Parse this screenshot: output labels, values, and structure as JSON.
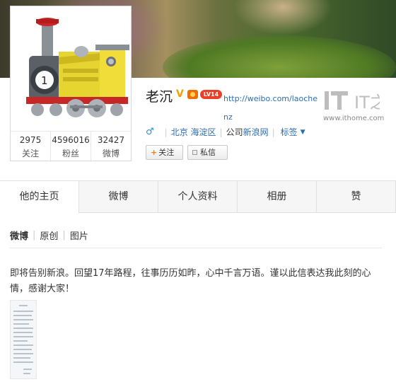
{
  "profile": {
    "name": "老沉",
    "verified_mark": "V",
    "level": "LV14",
    "url": "http://weibo.com/laochenz",
    "gender_icon": "male-icon",
    "location": "北京 海淀区",
    "company_label": "公司",
    "company": "新浪网",
    "tag_label": "标签"
  },
  "stats": [
    {
      "value": "2975",
      "label": "关注"
    },
    {
      "value": "4596016",
      "label": "粉丝"
    },
    {
      "value": "32427",
      "label": "微博"
    }
  ],
  "actions": {
    "follow": "关注",
    "message": "私信"
  },
  "watermark": {
    "logo": "IT之家",
    "url": "www.ithome.com"
  },
  "tabs": [
    "他的主页",
    "微博",
    "个人资料",
    "相册",
    "赞"
  ],
  "subtabs": [
    "微博",
    "原创",
    "图片"
  ],
  "post": {
    "text": "即将告别新浪。回望17年路程，往事历历如昨，心中千言万语。谨以此信表达我此刻的心情，感谢大家！"
  },
  "colors": {
    "link": "#2c6db0",
    "accent": "#ff7a00",
    "level": "#e8402a"
  }
}
